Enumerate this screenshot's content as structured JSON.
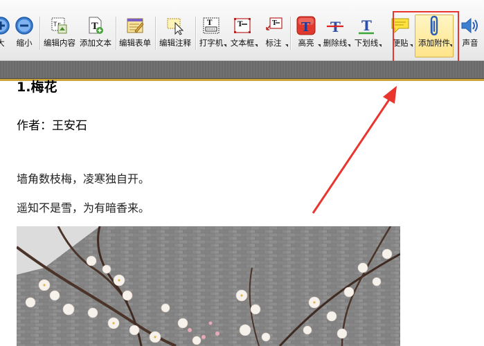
{
  "toolbar": {
    "buttons": [
      {
        "label": "大",
        "icon": "zoom-in-icon"
      },
      {
        "label": "缩小",
        "icon": "zoom-out-icon"
      },
      {
        "label": "编辑内容",
        "icon": "edit-content-icon"
      },
      {
        "label": "添加文本",
        "icon": "add-text-icon"
      },
      {
        "label": "编辑表单",
        "icon": "edit-form-icon"
      },
      {
        "label": "编辑注释",
        "icon": "edit-annotation-icon"
      },
      {
        "label": "打字机",
        "icon": "typewriter-icon"
      },
      {
        "label": "文本框",
        "icon": "text-box-icon"
      },
      {
        "label": "标注",
        "icon": "callout-icon"
      },
      {
        "label": "高亮",
        "icon": "highlight-icon"
      },
      {
        "label": "删除线",
        "icon": "strikethrough-icon"
      },
      {
        "label": "下划线",
        "icon": "underline-icon"
      },
      {
        "label": "便贴",
        "icon": "sticky-note-icon"
      },
      {
        "label": "添加附件",
        "icon": "paperclip-icon"
      },
      {
        "label": "声音",
        "icon": "sound-icon"
      }
    ],
    "active_button": "添加附件",
    "annotation_box_color": "#e8362f"
  },
  "document": {
    "title": "1.梅花",
    "author": "作者：王安石",
    "lines": [
      "墙角数枝梅，凌寒独自开。",
      "遥知不是雪，为有暗香来。"
    ],
    "image": "plum-blossom-photo"
  },
  "colors": {
    "toolbar_bg": "#eeeeee",
    "dark_bar": "#6d6d6d",
    "accent_yellow": "#c9a23a",
    "highlight_red": "#e8362f"
  }
}
